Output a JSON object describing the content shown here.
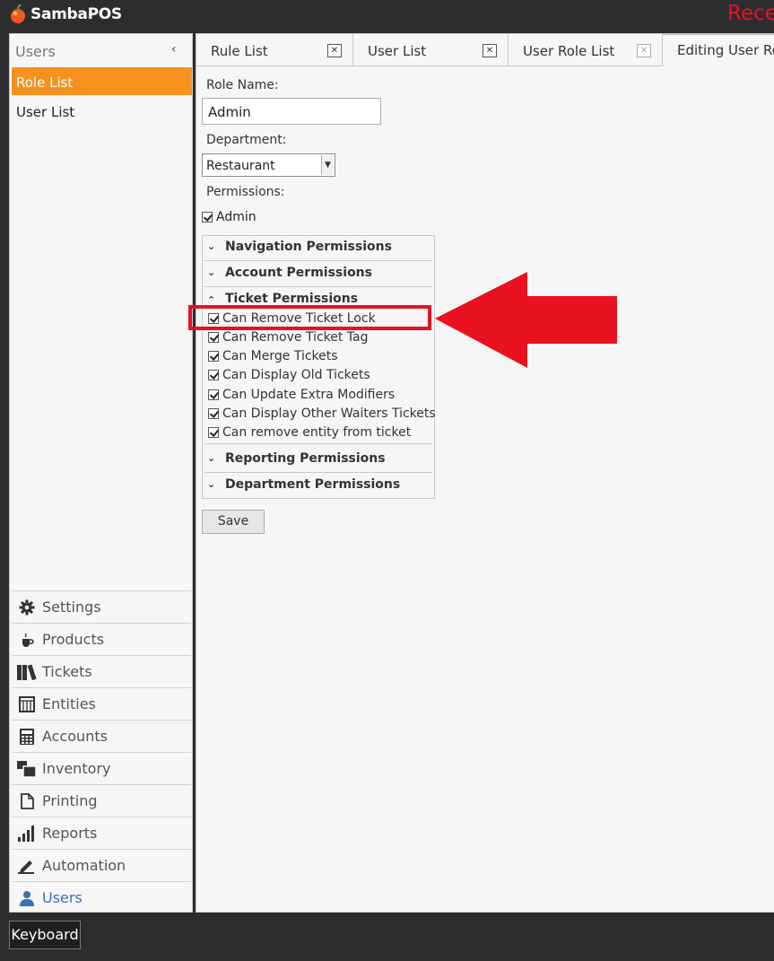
{
  "app": {
    "name": "SambaPOS",
    "recent_label": "Rece"
  },
  "sidebar": {
    "header": "Users",
    "collapse_icon": "chevron-left-icon",
    "items": [
      {
        "label": "Role List",
        "active": true
      },
      {
        "label": "User List",
        "active": false
      }
    ],
    "nav": [
      {
        "label": "Settings",
        "icon": "gear-icon"
      },
      {
        "label": "Products",
        "icon": "cup-icon"
      },
      {
        "label": "Tickets",
        "icon": "books-icon"
      },
      {
        "label": "Entities",
        "icon": "grid-icon"
      },
      {
        "label": "Accounts",
        "icon": "calculator-icon"
      },
      {
        "label": "Inventory",
        "icon": "boxes-icon"
      },
      {
        "label": "Printing",
        "icon": "document-icon"
      },
      {
        "label": "Reports",
        "icon": "bar-chart-icon"
      },
      {
        "label": "Automation",
        "icon": "pen-icon"
      },
      {
        "label": "Users",
        "icon": "user-icon",
        "selected": true
      }
    ]
  },
  "tabs": [
    {
      "label": "Rule List",
      "closable": true
    },
    {
      "label": "User List",
      "closable": true
    },
    {
      "label": "User Role List",
      "closable": true
    },
    {
      "label": "Editing User Ro",
      "active": true
    }
  ],
  "form": {
    "role_name_label": "Role Name:",
    "role_name_value": "Admin",
    "department_label": "Department:",
    "department_value": "Restaurant",
    "permissions_label": "Permissions:",
    "admin_label": "Admin",
    "admin_checked": true,
    "save_label": "Save"
  },
  "permission_groups": {
    "navigation": "Navigation Permissions",
    "account": "Account Permissions",
    "ticket": "Ticket Permissions",
    "reporting": "Reporting Permissions",
    "department": "Department Permissions"
  },
  "ticket_permissions": [
    {
      "label": "Can Remove Ticket Lock",
      "checked": true
    },
    {
      "label": "Can Remove Ticket Tag",
      "checked": true
    },
    {
      "label": "Can Merge Tickets",
      "checked": true
    },
    {
      "label": "Can Display Old Tickets",
      "checked": true
    },
    {
      "label": "Can Update Extra Modifiers",
      "checked": true
    },
    {
      "label": "Can Display Other Waiters Tickets",
      "checked": true
    },
    {
      "label": "Can remove entity from ticket",
      "checked": true
    }
  ],
  "footer": {
    "keyboard_label": "Keyboard"
  },
  "colors": {
    "accent_orange": "#f7911e",
    "annotation_red": "#e8111f",
    "title_bar": "#2d2d30",
    "selected_nav_blue": "#3a6fb4"
  }
}
